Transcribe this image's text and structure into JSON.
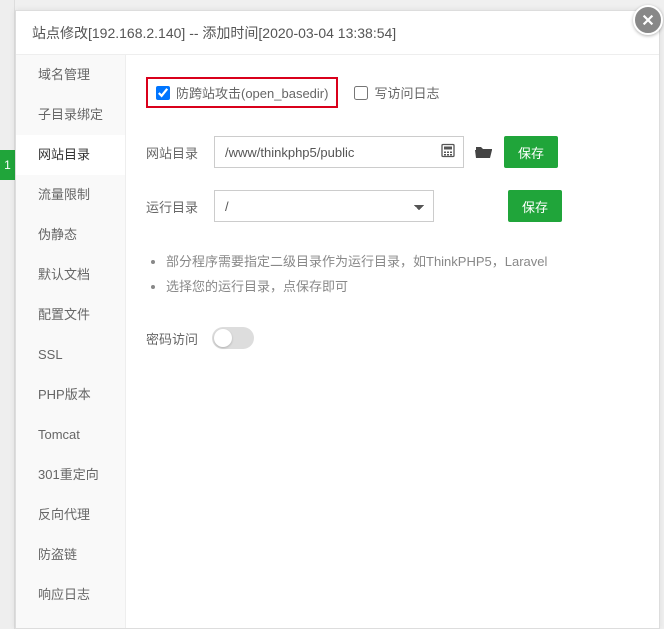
{
  "backdrop": {
    "badge": "1"
  },
  "dialog": {
    "title": "站点修改[192.168.2.140] -- 添加时间[2020-03-04 13:38:54]"
  },
  "sidebar": {
    "items": [
      {
        "label": "域名管理"
      },
      {
        "label": "子目录绑定"
      },
      {
        "label": "网站目录"
      },
      {
        "label": "流量限制"
      },
      {
        "label": "伪静态"
      },
      {
        "label": "默认文档"
      },
      {
        "label": "配置文件"
      },
      {
        "label": "SSL"
      },
      {
        "label": "PHP版本"
      },
      {
        "label": "Tomcat"
      },
      {
        "label": "301重定向"
      },
      {
        "label": "反向代理"
      },
      {
        "label": "防盗链"
      },
      {
        "label": "响应日志"
      }
    ],
    "active_index": 2
  },
  "content": {
    "cb_open_basedir": "防跨站攻击(open_basedir)",
    "cb_access_log": "写访问日志",
    "site_dir_label": "网站目录",
    "site_dir_value": "/www/thinkphp5/public",
    "run_dir_label": "运行目录",
    "run_dir_value": "/",
    "save_btn": "保存",
    "notes": [
      "部分程序需要指定二级目录作为运行目录，如ThinkPHP5，Laravel",
      "选择您的运行目录，点保存即可"
    ],
    "pwd_label": "密码访问"
  }
}
